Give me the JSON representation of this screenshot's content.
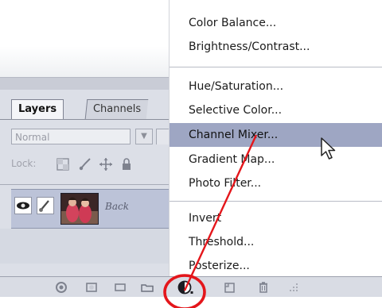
{
  "layers_panel": {
    "tabs": [
      {
        "label": "Layers",
        "active": true
      },
      {
        "label": "Channels",
        "active": false
      }
    ],
    "blend_mode": "Normal",
    "lock_label": "Lock:",
    "layer_name": "Back"
  },
  "adjustment_menu": {
    "groups": [
      [
        "Color Balance...",
        "Brightness/Contrast..."
      ],
      [
        "Hue/Saturation...",
        "Selective Color...",
        "Channel Mixer...",
        "Gradient Map...",
        "Photo Filter..."
      ],
      [
        "Invert",
        "Threshold...",
        "Posterize..."
      ]
    ],
    "highlighted": "Channel Mixer..."
  },
  "bottom_toolbar": {
    "icons": [
      "link-layers-icon",
      "layer-style-icon",
      "add-mask-icon",
      "new-group-icon",
      "new-adjustment-layer-icon",
      "new-layer-icon",
      "delete-layer-icon",
      "resize-grip-icon"
    ],
    "annotated_icon": "new-adjustment-layer-icon"
  },
  "colors": {
    "highlight": "#9ea6c3",
    "annotation": "#e4161b"
  }
}
